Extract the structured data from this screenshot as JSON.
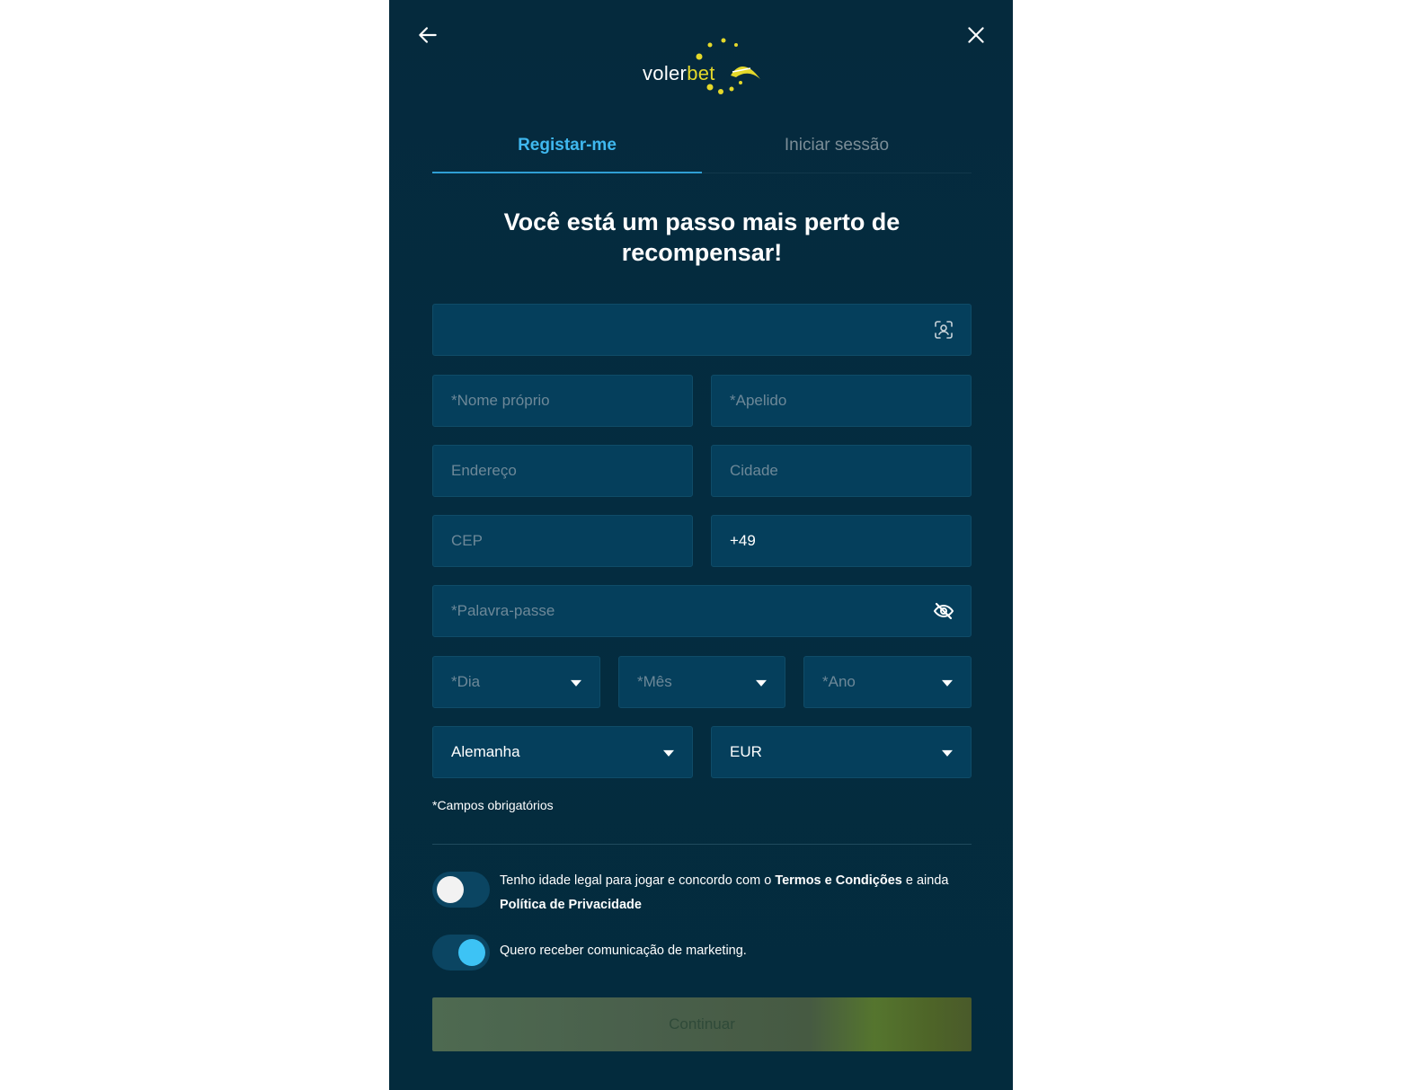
{
  "header": {
    "back_icon": "arrow-left-icon",
    "close_icon": "close-icon",
    "logo": {
      "text_white": "voler",
      "text_yellow": "bet"
    }
  },
  "tabs": [
    {
      "label": "Registar-me",
      "active": true
    },
    {
      "label": "Iniciar sessão",
      "active": false
    }
  ],
  "headline": {
    "line1": "Você está um passo mais perto de",
    "line2": "recompensar!"
  },
  "form": {
    "scan_field": {
      "value": "",
      "icon": "face-scan-icon"
    },
    "first_name": {
      "placeholder": "*Nome próprio"
    },
    "last_name": {
      "placeholder": "*Apelido"
    },
    "address": {
      "placeholder": "Endereço"
    },
    "city": {
      "placeholder": "Cidade"
    },
    "postcode": {
      "placeholder": "CEP"
    },
    "phone": {
      "value": "+49"
    },
    "password": {
      "placeholder": "*Palavra-passe",
      "icon": "eye-off-icon"
    },
    "day": {
      "placeholder": "*Dia"
    },
    "month": {
      "placeholder": "*Mês"
    },
    "year": {
      "placeholder": "*Ano"
    },
    "country": {
      "value": "Alemanha"
    },
    "currency": {
      "value": "EUR"
    },
    "required_note": "*Campos obrigatórios"
  },
  "consents": {
    "legal": {
      "checked": false,
      "text_before": "Tenho idade legal para jogar e concordo com o ",
      "terms_link": "Termos e Condições",
      "text_middle": " e ainda ",
      "privacy_link": "Política de Privacidade"
    },
    "marketing": {
      "checked": true,
      "text": "Quero receber comunicação de marketing."
    }
  },
  "continue_label": "Continuar",
  "colors": {
    "background": "#052a3d",
    "field_bg": "#053f5c",
    "accent_blue": "#3fb8ef",
    "logo_yellow": "#e4d82a"
  }
}
